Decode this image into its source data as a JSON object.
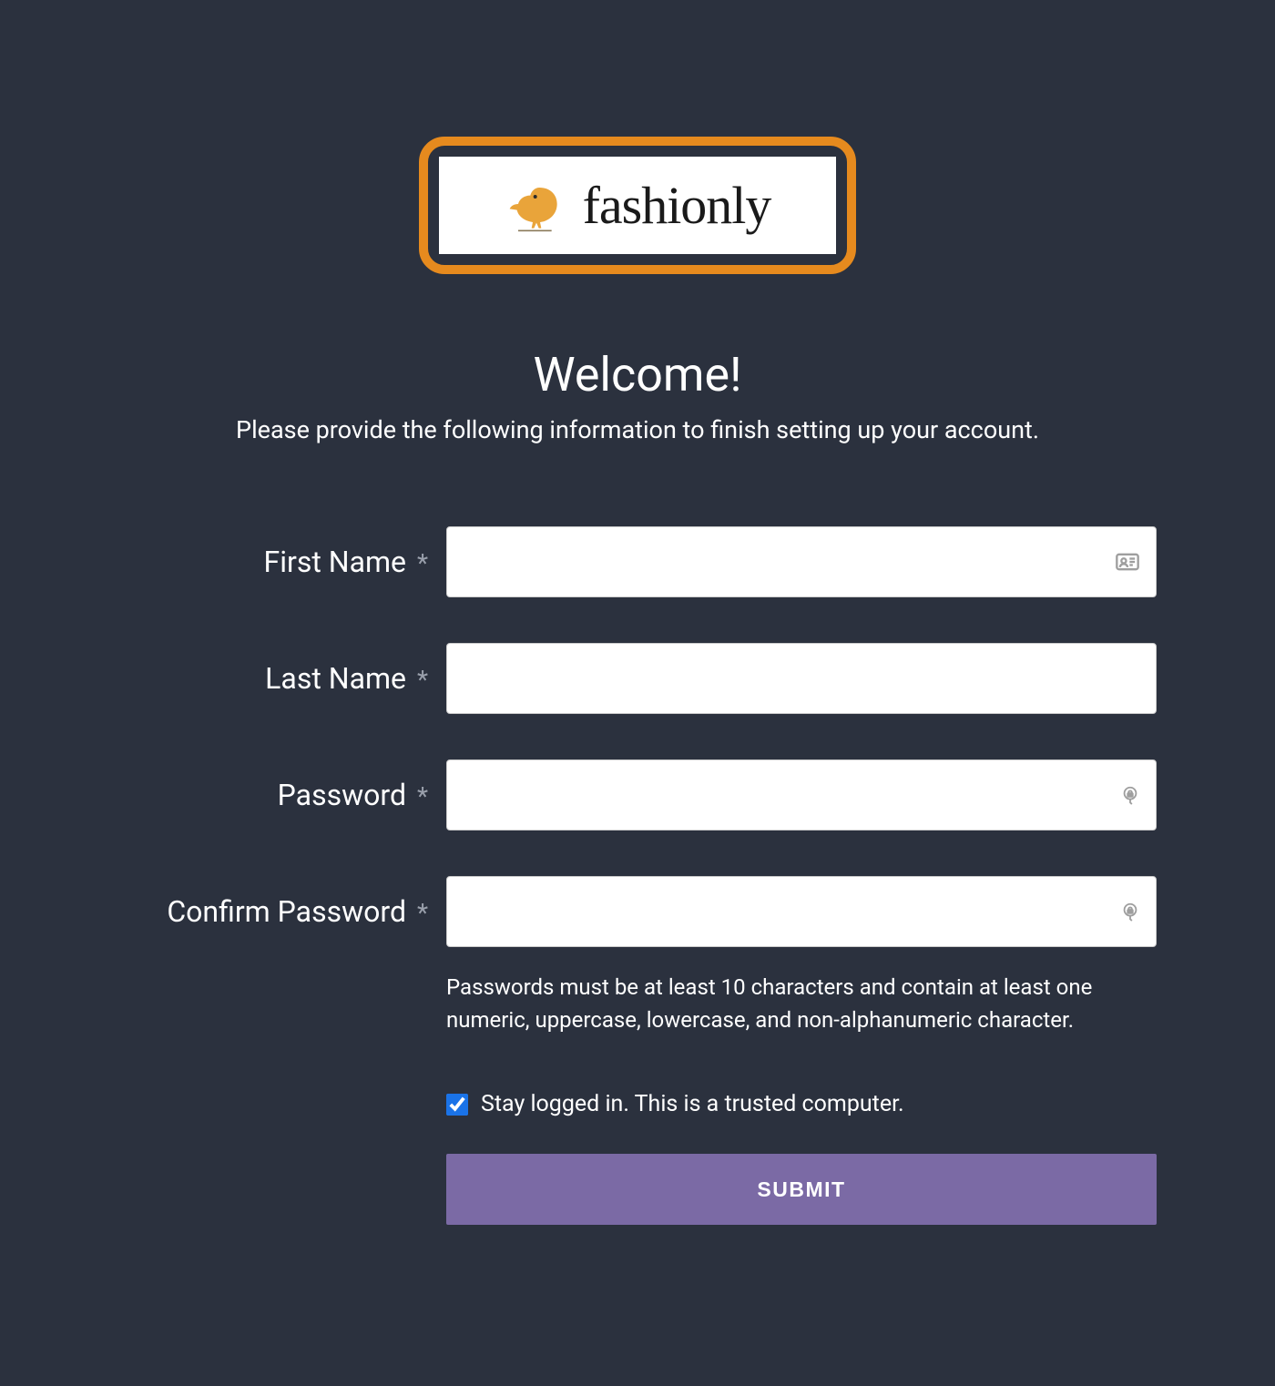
{
  "logo": {
    "brand_text": "fashionly"
  },
  "header": {
    "title": "Welcome!",
    "subtitle": "Please provide the following information to finish setting up your account."
  },
  "form": {
    "first_name": {
      "label": "First Name",
      "value": ""
    },
    "last_name": {
      "label": "Last Name",
      "value": ""
    },
    "password": {
      "label": "Password",
      "value": ""
    },
    "confirm_password": {
      "label": "Confirm Password",
      "value": ""
    },
    "required_mark": "*",
    "password_hint": "Passwords must be at least 10 characters and contain at least one numeric, uppercase, lowercase, and non-alphanumeric character.",
    "stay_logged_in": {
      "label": "Stay logged in. This is a trusted computer.",
      "checked": true
    },
    "submit_label": "SUBMIT"
  }
}
